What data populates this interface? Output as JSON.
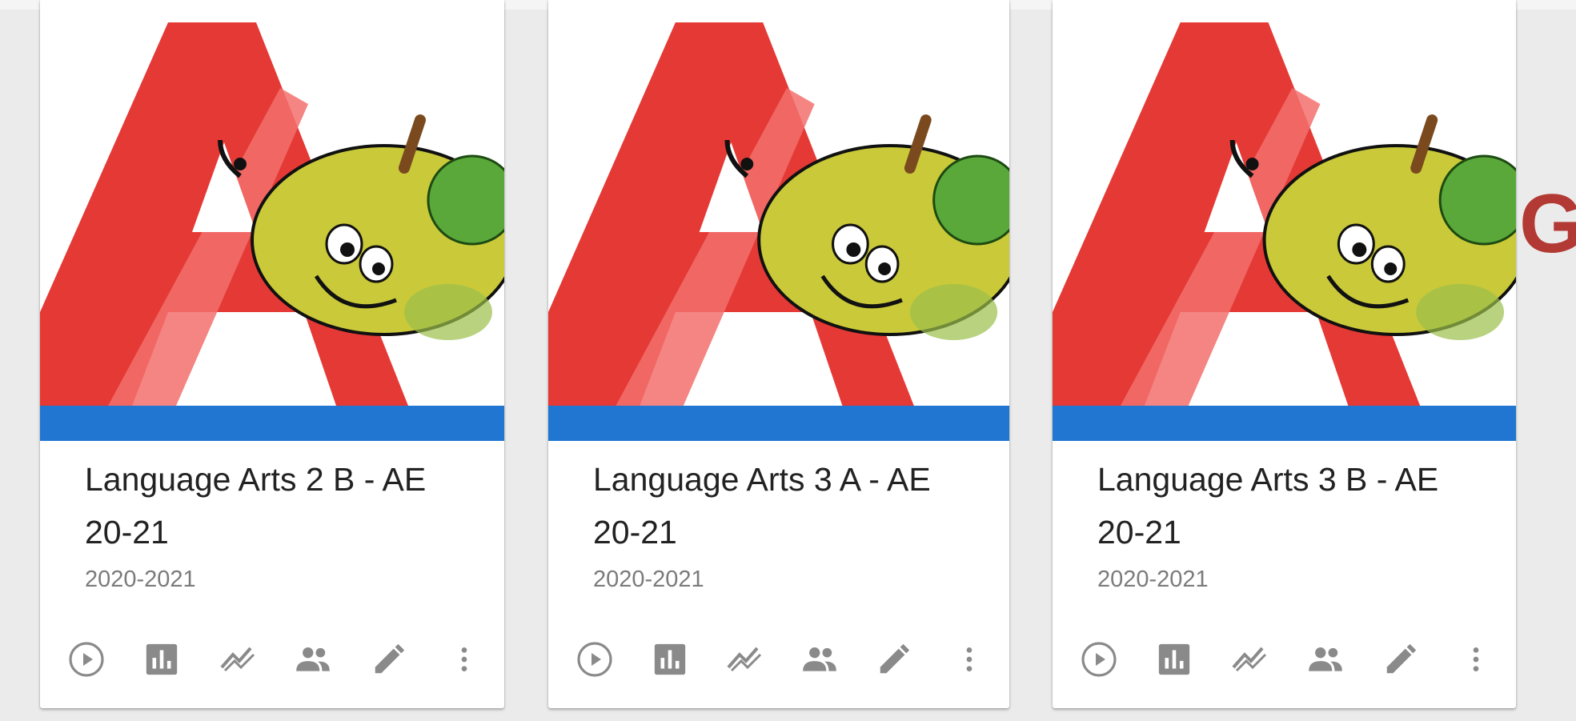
{
  "colors": {
    "accent_bar": "#2176d2",
    "brand_red": "#b23934",
    "letter_red": "#e53935",
    "letter_highlight": "#f2706c",
    "icon_gray": "#8a8a8a"
  },
  "cards": [
    {
      "title": "Language Arts 2 B - AE 20-21",
      "subtitle": "2020-2021",
      "image": "letter-a-apple-illustration",
      "actions": [
        "play-circle-icon",
        "bar-chart-icon",
        "trend-icon",
        "people-icon",
        "pencil-icon",
        "more-vert-icon"
      ]
    },
    {
      "title": "Language Arts 3 A - AE 20-21",
      "subtitle": "2020-2021",
      "image": "letter-a-apple-illustration",
      "actions": [
        "play-circle-icon",
        "bar-chart-icon",
        "trend-icon",
        "people-icon",
        "pencil-icon",
        "more-vert-icon"
      ]
    },
    {
      "title": "Language Arts 3 B - AE 20-21",
      "subtitle": "2020-2021",
      "image": "letter-a-apple-illustration",
      "actions": [
        "play-circle-icon",
        "bar-chart-icon",
        "trend-icon",
        "people-icon",
        "pencil-icon",
        "more-vert-icon"
      ]
    }
  ],
  "edge": {
    "partial_heading": "G"
  }
}
